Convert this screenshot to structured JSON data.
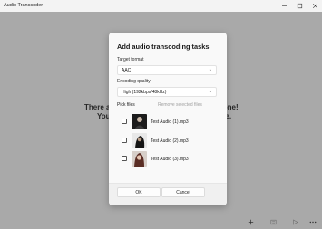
{
  "window": {
    "title": "Audio Transcoder",
    "controls": {
      "minimize": "—",
      "maximize": "☐",
      "close": "✕"
    }
  },
  "background": {
    "line1_left": "There ar",
    "line2_left": "You",
    "line1_right": "new one!",
    "line2_right": "here."
  },
  "dialog": {
    "title": "Add audio transcoding tasks",
    "target_format_label": "Target format",
    "target_format_value": "AAC",
    "quality_label": "Encoding quality",
    "quality_value": "High (192kbps/48kHz)",
    "pick_files_label": "Pick files",
    "remove_selected_label": "Remove selected files",
    "files": [
      {
        "name": "Test Audio (1).mp3",
        "checked": false,
        "thumb": "portrait-dark-1"
      },
      {
        "name": "Test Audio (2).mp3",
        "checked": false,
        "thumb": "portrait-dark-2"
      },
      {
        "name": "Test Audio (3).mp3",
        "checked": false,
        "thumb": "portrait-light-3"
      }
    ],
    "ok_label": "OK",
    "cancel_label": "Cancel"
  },
  "toolbar": {
    "add_icon": "plus-icon",
    "list_icon": "list-icon",
    "play_icon": "play-icon",
    "more_icon": "more-icon"
  },
  "colors": {
    "overlay": "#000000",
    "dialog_bg": "#f9f9f9",
    "disabled_text": "#a0a0a0"
  }
}
